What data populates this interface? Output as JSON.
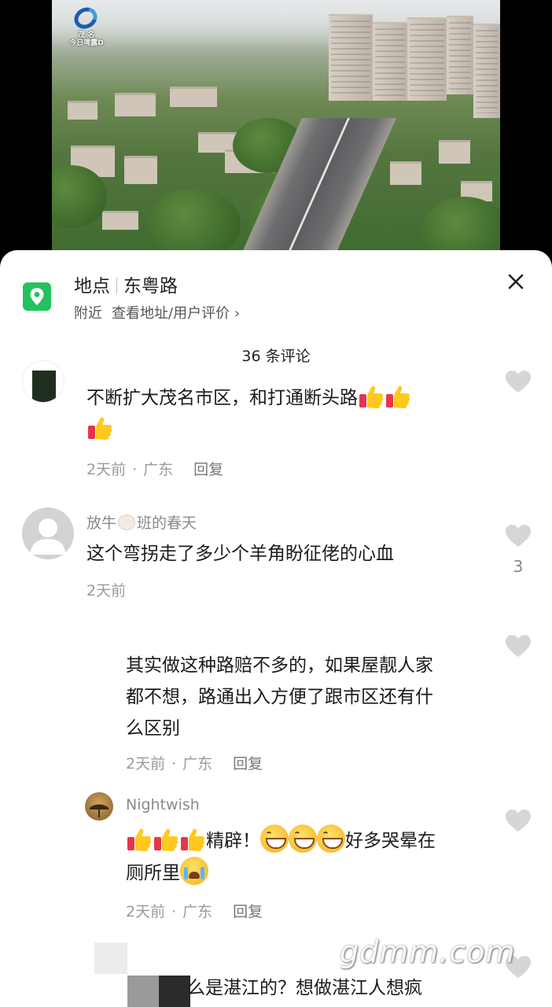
{
  "video": {
    "logo_text_top": "茂 名",
    "logo_text_bottom": "今日啤露D"
  },
  "location": {
    "label": "地点",
    "name": "东粤路",
    "nearby": "附近",
    "view_link": "查看地址/用户评价",
    "chevron": "›"
  },
  "comments_count": "36 条评论",
  "comments": [
    {
      "text": "不断扩大茂名市区，和打通断头路",
      "time": "2天前",
      "region": "广东",
      "reply": "回复"
    },
    {
      "name": "放牛",
      "name_suffix": "班的春天",
      "text": "这个弯拐走了多少个羊角盼征佬的心血",
      "time": "2天前",
      "likes": "3"
    },
    {
      "text_line1": "其实做这种路赔不多的，如果屋靓人家",
      "text_line2": "都不想，路通出入方便了跟市区还有什",
      "text_line3": "么区别",
      "time": "2天前",
      "region": "广东",
      "reply": "回复"
    },
    {
      "name": "Nightwish",
      "text_a": "精辟！",
      "text_b": "好多哭晕在",
      "text_c": "厕所里",
      "time": "2天前",
      "region": "广东",
      "reply": "回复"
    },
    {
      "text": "么是湛江的？想做湛江人想疯"
    }
  ],
  "watermark": "gdmm.com",
  "icons": {
    "location": "location-pin-icon",
    "close": "close-icon",
    "like": "heart-icon",
    "thumb": "thumbs-up-emoji",
    "grin": "grinning-emoji",
    "cry": "crying-emoji"
  },
  "colors": {
    "accent_green": "#22c35e",
    "text_primary": "#1b1b1b",
    "text_secondary": "#8a8a8a",
    "like_gray": "#d6d6d6"
  }
}
